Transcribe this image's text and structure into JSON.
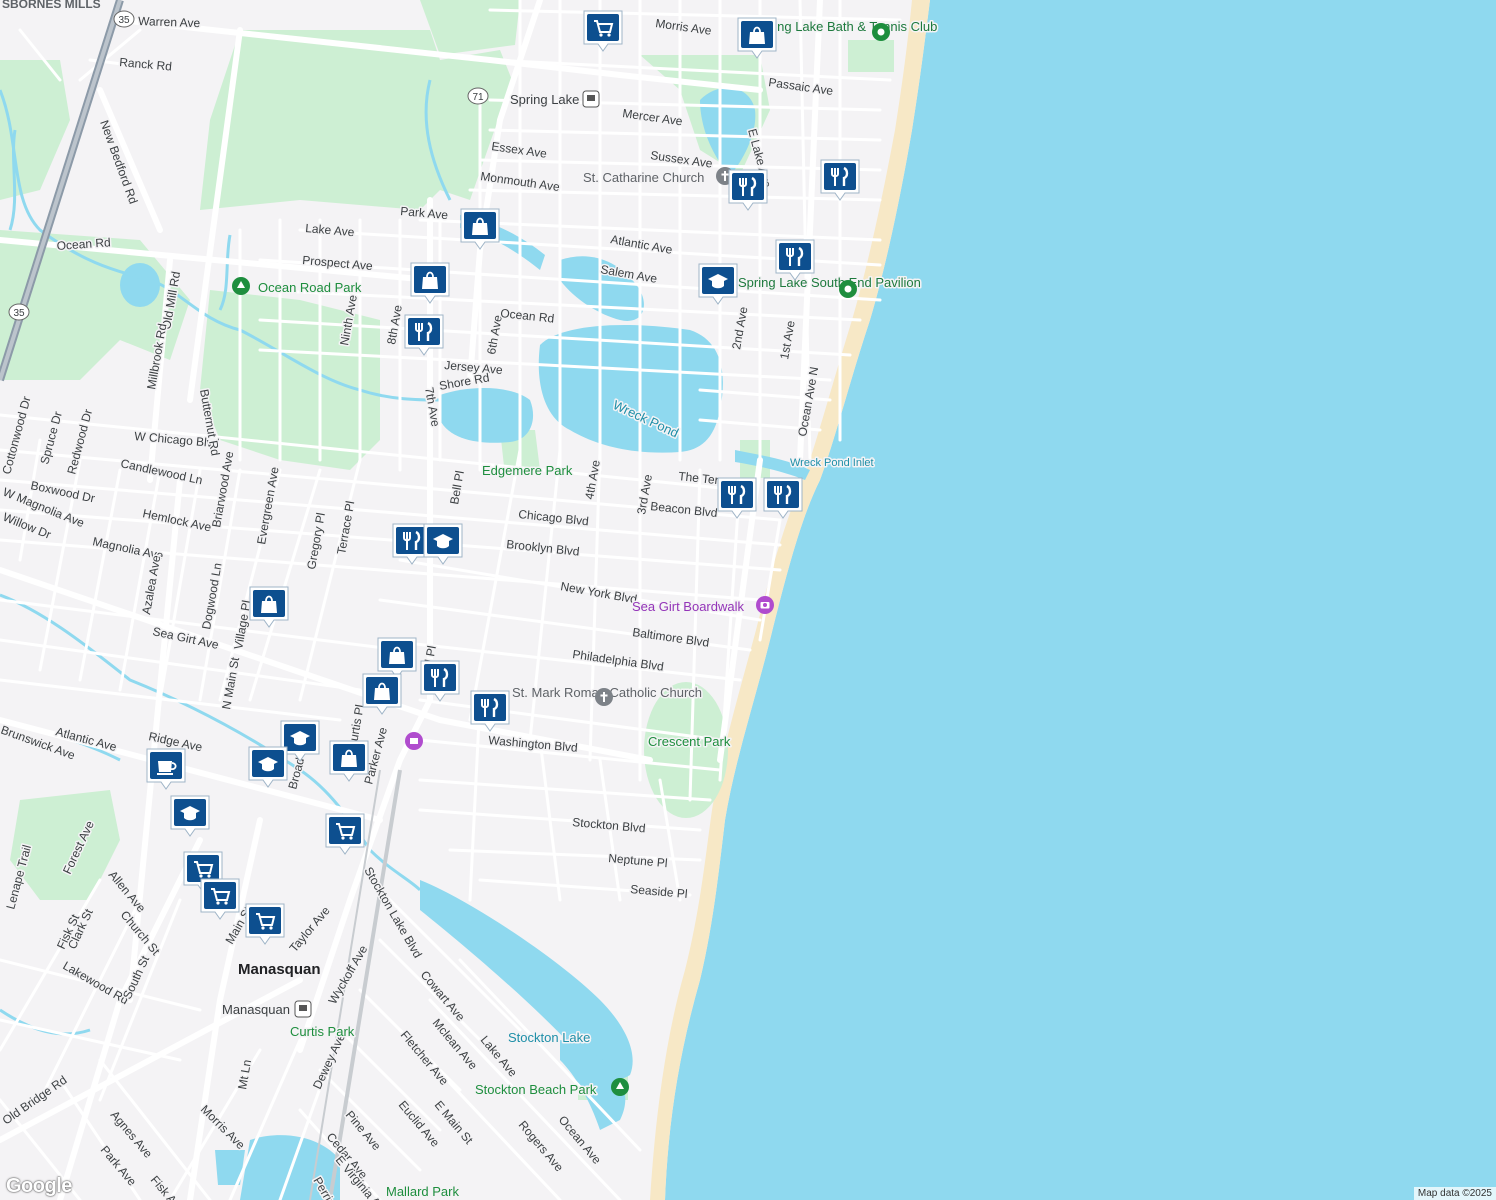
{
  "map": {
    "attribution": "Map data ©2025",
    "logo": "Google",
    "colors": {
      "land": "#f4f3f5",
      "water": "#8fd9ef",
      "park": "#cdefd3",
      "beach": "#f7e8c6",
      "road": "#ffffff",
      "pin": "#0d4f8f"
    },
    "town_labels": [
      "Manasquan",
      "SBORNES MILLS"
    ],
    "park_labels": [
      "Edgemere Park",
      "Crescent Park",
      "Ocean Road Park",
      "Curtis Park",
      "Stockton Beach Park",
      "Mallard Park"
    ],
    "water_labels": [
      "Wreck Pond",
      "Stockton Lake",
      "Wreck Pond Inlet"
    ],
    "poi_labels": {
      "spring_lake_bath": "Spring Lake Bath & Tennis Club",
      "south_end_pavilion": "Spring Lake South End Pavilion",
      "st_catharine": "St. Catharine Church",
      "st_mark": "St. Mark Roman Catholic Church",
      "boardwalk": "Sea Girt Boardwalk",
      "spring_lake_station": "Spring Lake",
      "manasquan_station": "Manasquan"
    },
    "highways": [
      "35",
      "71",
      "35"
    ],
    "streets": [
      "Warren Ave",
      "Morris Ave",
      "Passaic Ave",
      "Mercer Ave",
      "Sussex Ave",
      "Essex Ave",
      "Monmouth Ave",
      "Park Ave",
      "Lake Ave",
      "Prospect Ave",
      "Ocean Rd",
      "Atlantic Ave",
      "Salem Ave",
      "Jersey Ave",
      "Shore Rd",
      "W Chicago Blvd",
      "Chicago Blvd",
      "Brooklyn Blvd",
      "New York Blvd",
      "Baltimore Blvd",
      "Philadelphia Blvd",
      "Washington Blvd",
      "Stockton Blvd",
      "Neptune Pl",
      "Seaside Pl",
      "Beacon Blvd",
      "The Terrace",
      "Sea Girt Ave",
      "Magnolia Ave",
      "Hemlock Ave",
      "Candlewood Ln",
      "Boxwood Dr",
      "W Magnolia Ave",
      "Willow Dr",
      "Ranck Rd",
      "New Bedford Rd",
      "Old Mill Rd",
      "Millbrook Rd",
      "Butternut Rd",
      "Ninth Ave",
      "8th Ave",
      "7th Ave",
      "6th Ave",
      "4th Ave",
      "3rd Ave",
      "2nd Ave",
      "1st Ave",
      "E Lake Ave",
      "Ocean Ave N",
      "Bell Pl",
      "Terrace Pl",
      "Gregory Pl",
      "Evergreen Ave",
      "Briarwood Ave",
      "Azalea Ave",
      "Dogwood Ln",
      "Village Pl",
      "N Main St",
      "Ridge Ave",
      "Atlantic Ave",
      "Brunswick Ave",
      "Broad St",
      "Curtis Pl",
      "Parker Ave",
      "Taylor Ave",
      "Stockton Lake Blvd",
      "Wyckoff Ave",
      "Cowart Ave",
      "Mclean Ave",
      "Lake Ave",
      "Fletcher Ave",
      "Dewey Ave",
      "Euclid Ave",
      "E Main St",
      "Rogers Ave",
      "Ocean Ave",
      "Pine Ave",
      "Cedar Ave",
      "E Virginia Ave",
      "Perrine Blvd",
      "Morris Ave",
      "Mt Ln",
      "Old Bridge Rd",
      "Agnes Ave",
      "Park Ave",
      "Fisk Ave",
      "Lakewood Rd",
      "South St",
      "Church St",
      "Clark St",
      "Fisk St",
      "Allen Ave",
      "Forest Ave",
      "Lenape Trail",
      "Cottonwood Dr",
      "Spruce Dr",
      "Redwood Dr",
      "Main St",
      "Ocean Rd",
      "Bell Pl"
    ],
    "markers": [
      {
        "type": "shopping-cart",
        "icon": "cart"
      },
      {
        "type": "shopping-bag",
        "icon": "bag"
      },
      {
        "type": "shopping-bag",
        "icon": "bag"
      },
      {
        "type": "restaurant",
        "icon": "fork"
      },
      {
        "type": "restaurant",
        "icon": "fork"
      },
      {
        "type": "restaurant",
        "icon": "fork"
      },
      {
        "type": "shopping-bag",
        "icon": "bag"
      },
      {
        "type": "school",
        "icon": "cap"
      },
      {
        "type": "restaurant",
        "icon": "fork"
      },
      {
        "type": "restaurant",
        "icon": "fork"
      },
      {
        "type": "restaurant",
        "icon": "fork"
      },
      {
        "type": "restaurant",
        "icon": "fork"
      },
      {
        "type": "school",
        "icon": "cap"
      },
      {
        "type": "shopping-bag",
        "icon": "bag"
      },
      {
        "type": "shopping-bag",
        "icon": "bag"
      },
      {
        "type": "shopping-bag",
        "icon": "bag"
      },
      {
        "type": "restaurant",
        "icon": "fork"
      },
      {
        "type": "restaurant",
        "icon": "fork"
      },
      {
        "type": "cafe",
        "icon": "cup"
      },
      {
        "type": "school",
        "icon": "cap"
      },
      {
        "type": "school",
        "icon": "cap"
      },
      {
        "type": "school",
        "icon": "cap"
      },
      {
        "type": "shopping-bag",
        "icon": "bag"
      },
      {
        "type": "shopping-cart",
        "icon": "cart"
      },
      {
        "type": "shopping-cart",
        "icon": "cart"
      },
      {
        "type": "shopping-cart",
        "icon": "cart"
      },
      {
        "type": "shopping-cart",
        "icon": "cart"
      }
    ]
  }
}
